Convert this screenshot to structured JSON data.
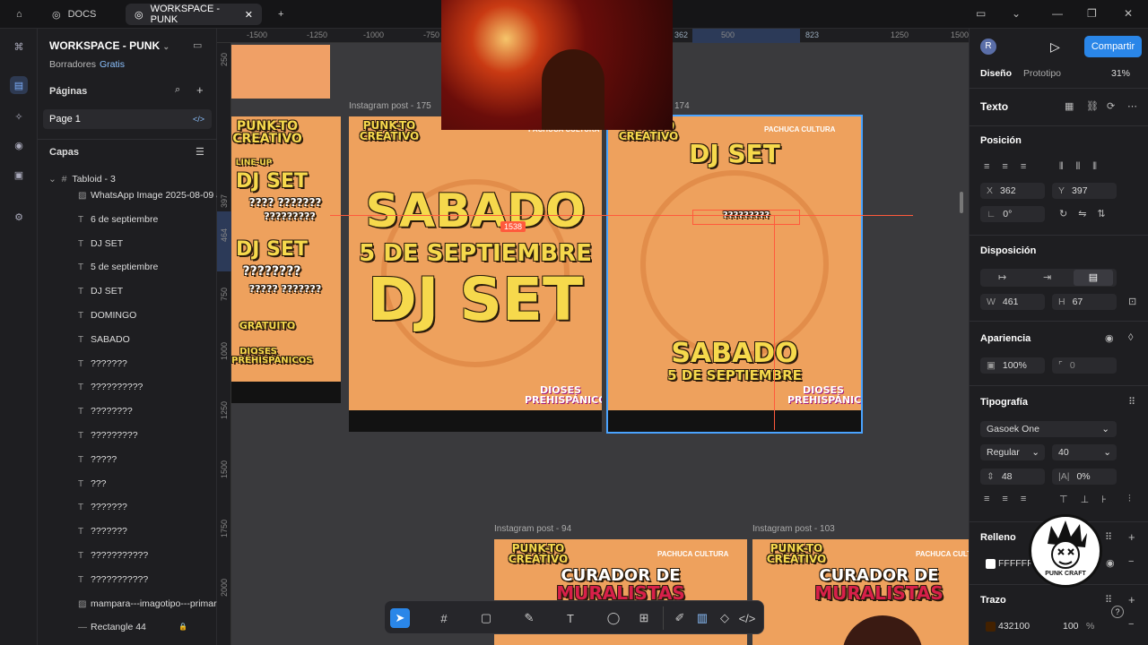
{
  "tabs": {
    "home_icon": "home-icon",
    "docs": "DOCS",
    "workspace": "WORKSPACE - PUNK",
    "new": "+"
  },
  "left": {
    "title": "WORKSPACE - PUNK",
    "drafts": "Borradores",
    "plan": "Gratis",
    "pages_label": "Páginas",
    "page1": "Page 1",
    "layers_label": "Capas",
    "board": "Tabloid - 3",
    "layers": [
      "WhatsApp Image 2025-08-09 a",
      "6 de septiembre",
      "DJ SET",
      "5 de septiembre",
      "DJ SET",
      "DOMINGO",
      "SABADO",
      "???????",
      "??????????",
      "????????",
      "?????????",
      "?????",
      "???",
      "???????",
      "???????",
      "???????????",
      "???????????",
      "mampara---imagotipo---primari",
      "Rectangle 44"
    ]
  },
  "rulers": {
    "top": [
      "-1500",
      "-1250",
      "-1000",
      "-750",
      "362",
      "500",
      "823",
      "1250",
      "1500"
    ],
    "left": [
      "250",
      "397",
      "464",
      "750",
      "1000",
      "1250",
      "1500",
      "1750",
      "2000"
    ]
  },
  "canvas": {
    "frame1_label": "Instagram post - 175",
    "frame2_label": "174",
    "frame3_label": "Instagram post - 94",
    "frame4_label": "Instagram post - 103",
    "badge": "1538",
    "p1": {
      "l1": "SABADO",
      "l2": "5 DE SEPTIEMBRE",
      "l3": "DJ SET",
      "brand": "PUNK-TO CREATIVO",
      "pachuca": "PACHUCA",
      "cultura": "CULTURA",
      "dioses": "DIOSES PREHISPÁNICOS"
    },
    "p2": {
      "top": "DJ SET",
      "q": "?????????",
      "l1": "SABADO",
      "l2": "5 DE SEPTIEMBRE",
      "brand": "PUNK-TO CREATIVO",
      "pachuca": "PACHUCA",
      "cultura": "CULTURA",
      "dioses": "DIOSES PREHISPÁNICOS"
    },
    "p0": {
      "lineup": "LINE-UP",
      "djset": "DJ SET",
      "q1": "????  ???????",
      "q2": "?????????",
      "djset2": "DJ SET",
      "q3": "????????",
      "q4": "?????  ???????",
      "gratuito": "GRATUITO",
      "dioses": "DIOSES PREHISPÁNICOS",
      "brand": "PUNK-TO CREATIVO"
    },
    "p3": {
      "brand": "PUNK-TO CREATIVO",
      "l1": "CURADOR DE",
      "l2": "MURALISTAS",
      "pachuca": "PACHUCA",
      "cultura": "CULTURA"
    },
    "p4": {
      "brand": "PUNK-TO CREATIVO",
      "l1": "CURADOR DE",
      "l2": "MURALISTAS",
      "pachuca": "PACHUCA",
      "cultura": "CULTURA"
    }
  },
  "right": {
    "avatar": "R",
    "share": "Compartir",
    "tab_design": "Diseño",
    "tab_proto": "Prototipo",
    "zoom": "31%",
    "text_label": "Texto",
    "position": "Posición",
    "x_k": "X",
    "x": "362",
    "y_k": "Y",
    "y": "397",
    "rot": "0°",
    "layout": "Disposición",
    "w_k": "W",
    "w": "461",
    "h_k": "H",
    "h": "67",
    "appearance": "Apariencia",
    "opacity": "100%",
    "radius": "0",
    "typography": "Tipografía",
    "font": "Gasoek One",
    "weight": "Regular",
    "size": "40",
    "line_height": "48",
    "letter": "0%",
    "fill": "Relleno",
    "fill_hex": "FFFFFF",
    "stroke": "Trazo",
    "stroke_hex": "432100",
    "stroke_op": "100",
    "pct": "%",
    "help": "?",
    "logo_text": "PUNK CRAFT"
  },
  "colors": {
    "accent": "#2a86e8",
    "poster": "#eea15d",
    "poster_text": "#f6d94c",
    "selection": "#ff5a3c"
  }
}
